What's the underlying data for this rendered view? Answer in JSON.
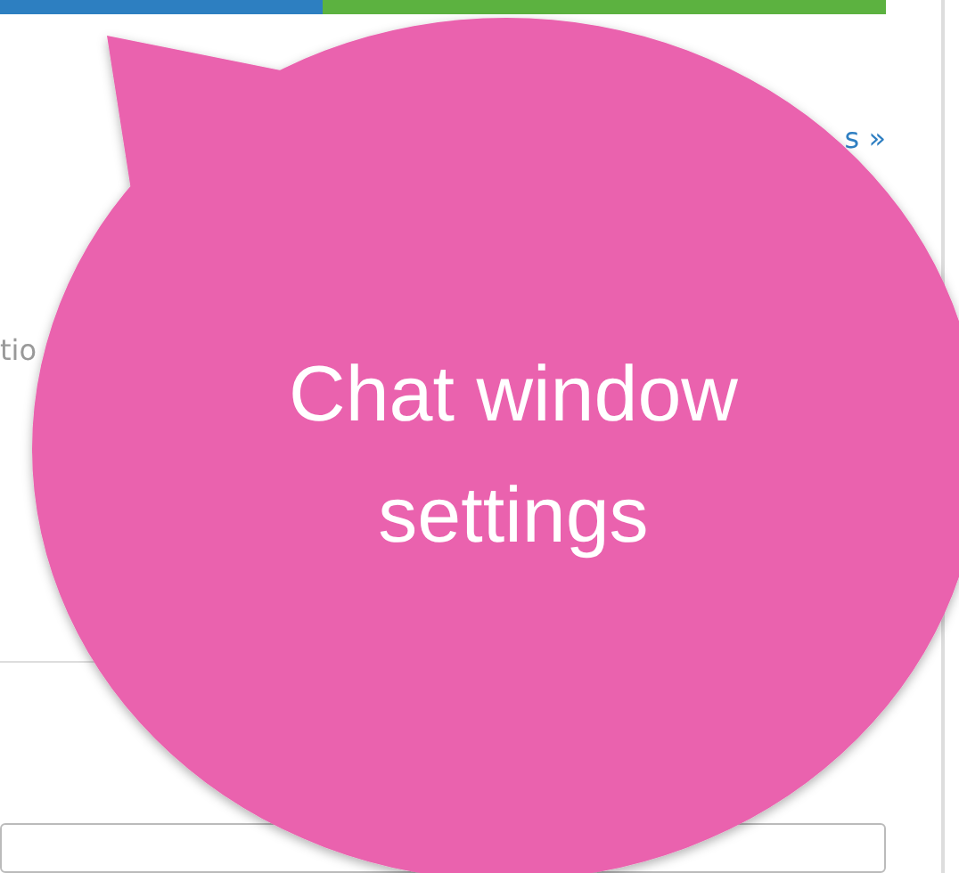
{
  "header_tabs": [
    {
      "kind": "blue"
    },
    {
      "kind": "green"
    }
  ],
  "link": {
    "label": "s »"
  },
  "description": {
    "text": "tio"
  },
  "callout": {
    "text": "Chat window settings"
  }
}
